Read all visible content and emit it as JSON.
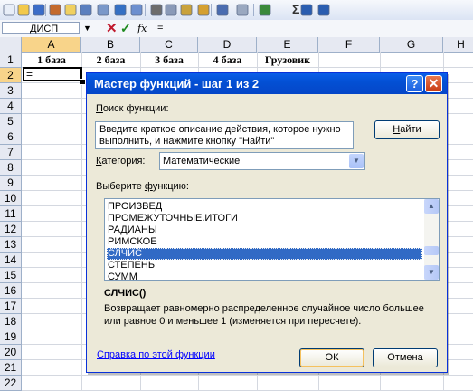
{
  "formula_bar": {
    "name_box": "ДИСП",
    "name_drop": "▼",
    "cancel": "✕",
    "enter": "✓",
    "fx": "fx",
    "content": "="
  },
  "toolbar_icons": [
    "new-icon",
    "open-icon",
    "save-icon",
    "permission-icon",
    "email-icon",
    "print-icon",
    "print-preview-icon",
    "spelling-icon",
    "research-icon",
    "cut-icon",
    "copy-icon",
    "paste-icon",
    "format-painter-icon",
    "undo-icon",
    "redo-icon",
    "hyperlink-icon",
    "autosum-icon",
    "sort-ascending-icon",
    "sort-descending-icon"
  ],
  "autosum": "Σ",
  "columns": [
    "A",
    "B",
    "C",
    "D",
    "E",
    "F",
    "G",
    "H"
  ],
  "rows": [
    "1",
    "2",
    "3",
    "4",
    "5",
    "6",
    "7",
    "8",
    "9",
    "10",
    "11",
    "12",
    "13",
    "14",
    "15",
    "16",
    "17",
    "18",
    "19",
    "20",
    "21",
    "22"
  ],
  "row1": [
    "1 база",
    "2 база",
    "3 база",
    "4 база",
    "Грузовик"
  ],
  "active_cell": {
    "value": "="
  },
  "dialog": {
    "title": "Мастер функций - шаг 1 из 2",
    "help": "?",
    "close": "✕",
    "search_label_u": "П",
    "search_label_rest": "оиск функции:",
    "search_text": "Введите краткое описание действия, которое нужно выполнить, и нажмите кнопку \"Найти\"",
    "find_u": "Н",
    "find_rest": "айти",
    "category_label_u": "К",
    "category_label_rest": "атегория:",
    "category_value": "Математические",
    "select_label_rest": "Выберите ",
    "select_label_u": "ф",
    "select_label_end": "ункцию:",
    "functions": [
      "ПРОИЗВЕД",
      "ПРОМЕЖУТОЧНЫЕ.ИТОГИ",
      "РАДИАНЫ",
      "РИМСКОЕ",
      "СЛЧИС",
      "СТЕПЕНЬ",
      "СУММ"
    ],
    "selected_index": 4,
    "function_name": "СЛЧИС()",
    "function_desc": "Возвращает равномерно распределенное случайное число большее или равное 0 и меньшее 1 (изменяется при пересчете).",
    "help_link": "Справка по этой функции",
    "ok": "ОК",
    "cancel": "Отмена"
  },
  "colors": {
    "title_bar": "#0350d4",
    "selection": "#316ac5",
    "header_selected": "#f8d48a"
  }
}
